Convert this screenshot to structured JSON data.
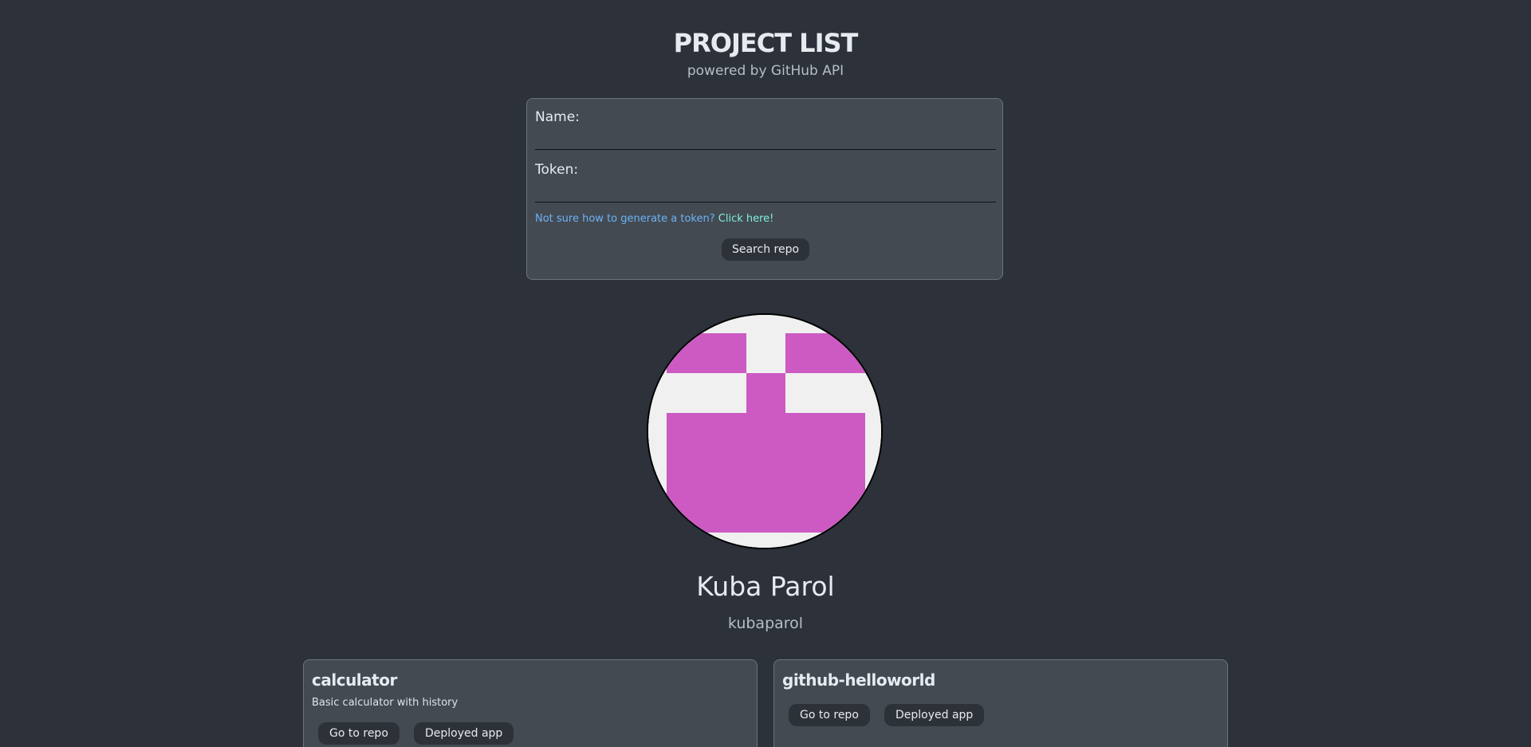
{
  "header": {
    "title": "PROJECT LIST",
    "subtitle": "powered by GitHub API"
  },
  "form": {
    "name_label": "Name:",
    "name_value": "",
    "token_label": "Token:",
    "token_value": "",
    "hint_text": "Not sure how to generate a token?",
    "hint_link": "Click here!",
    "search_button": "Search repo"
  },
  "user": {
    "name": "Kuba Parol",
    "login": "kubaparol",
    "avatar_colors": {
      "background": "#f0f0f0",
      "foreground": "#cc5ac2"
    }
  },
  "repos": [
    {
      "name": "calculator",
      "description": "Basic calculator with history",
      "repo_button": "Go to repo",
      "app_button": "Deployed app"
    },
    {
      "name": "github-helloworld",
      "description": "",
      "repo_button": "Go to repo",
      "app_button": "Deployed app"
    }
  ],
  "colors": {
    "page_background": "#2c313a",
    "card_background": "#444a52",
    "button_background": "#2d3238",
    "hint_color": "#6bb3f5",
    "link_color": "#7ff0dd"
  }
}
